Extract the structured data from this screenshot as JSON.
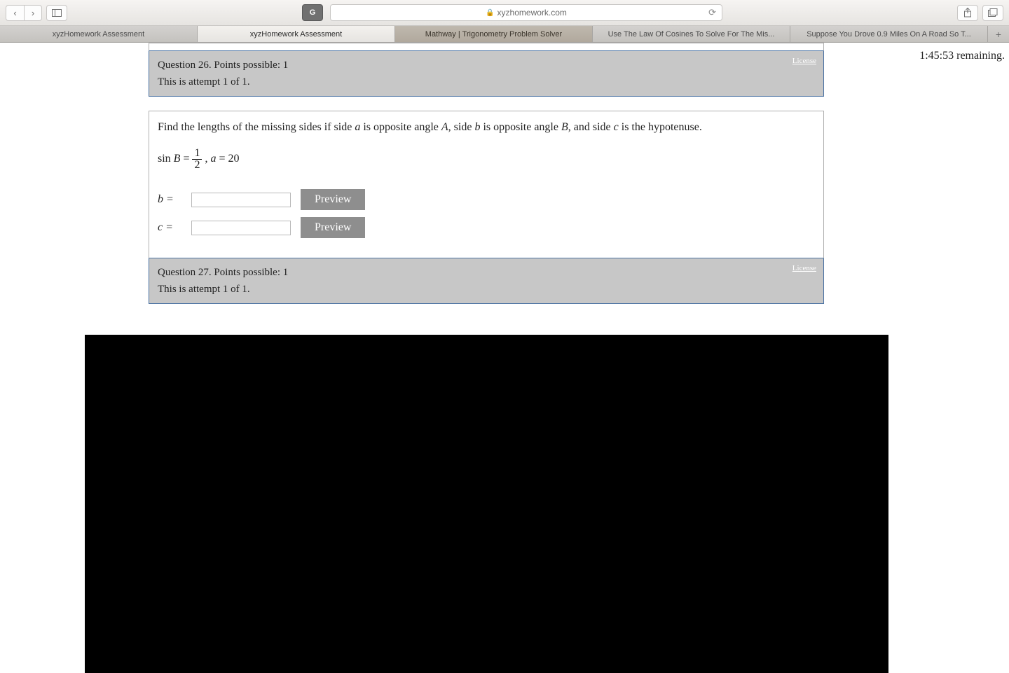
{
  "browser": {
    "url_host": "xyzhomework.com",
    "tabs": [
      {
        "label": "xyzHomework Assessment",
        "state": "inactive"
      },
      {
        "label": "xyzHomework Assessment",
        "state": "active"
      },
      {
        "label": "Mathway | Trigonometry Problem Solver",
        "state": "dark"
      },
      {
        "label": "Use The Law Of Cosines To Solve For The Mis...",
        "state": "inactive"
      },
      {
        "label": "Suppose You Drove 0.9 Miles On A Road So T...",
        "state": "inactive"
      }
    ],
    "new_tab": "+"
  },
  "timer": "1:45:53 remaining.",
  "q26": {
    "line1": "Question 26. Points possible: 1",
    "line2": "This is attempt 1 of 1.",
    "license": "License"
  },
  "question": {
    "prompt_before_a": "Find the lengths of the missing sides if side ",
    "a": "a",
    "prompt_mid1": " is opposite angle ",
    "A": "A",
    "prompt_mid2": ", side ",
    "b": "b",
    "prompt_mid3": " is opposite angle ",
    "B": "B",
    "prompt_mid4": ", and side ",
    "c": "c",
    "prompt_end": " is the hypotenuse.",
    "sin": "sin ",
    "Bvar": "B",
    "eq": " = ",
    "frac_n": "1",
    "frac_d": "2",
    "comma_a": " , ",
    "avar": "a",
    "a_val": " = 20",
    "row_b": "b =",
    "row_c": "c =",
    "preview": "Preview"
  },
  "q27": {
    "line1": "Question 27. Points possible: 1",
    "line2": "This is attempt 1 of 1.",
    "license": "License"
  }
}
